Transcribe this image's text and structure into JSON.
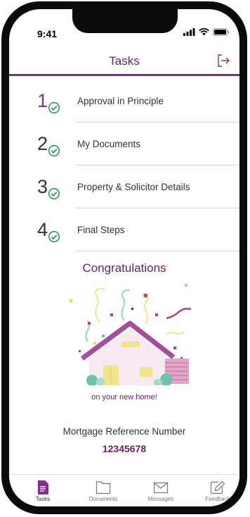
{
  "status_bar": {
    "time": "9:41",
    "icons": [
      "signal-icon",
      "wifi-icon",
      "battery-icon"
    ]
  },
  "header": {
    "title": "Tasks",
    "logout_icon": "logout-icon"
  },
  "tasks": [
    {
      "number": "1",
      "label": "Approval in Principle",
      "completed": true
    },
    {
      "number": "2",
      "label": "My Documents",
      "completed": true
    },
    {
      "number": "3",
      "label": "Property & Solicitor Details",
      "completed": true
    },
    {
      "number": "4",
      "label": "Final Steps",
      "completed": true
    }
  ],
  "congratulations": {
    "title": "Congratulations",
    "subtitle": "on your new home!"
  },
  "mortgage": {
    "label": "Mortgage Reference Number",
    "number": "12345678"
  },
  "tabbar": {
    "items": [
      {
        "label": "Tasks",
        "icon": "document-filled-icon",
        "active": true
      },
      {
        "label": "Documents",
        "icon": "folder-icon",
        "active": false
      },
      {
        "label": "Messages",
        "icon": "envelope-icon",
        "active": false
      },
      {
        "label": "Feedback",
        "icon": "feedback-edit-icon",
        "active": false
      }
    ]
  },
  "colors": {
    "brand": "#6a1c6f",
    "accent": "#8a2a8c",
    "check": "#2e9a5e"
  }
}
